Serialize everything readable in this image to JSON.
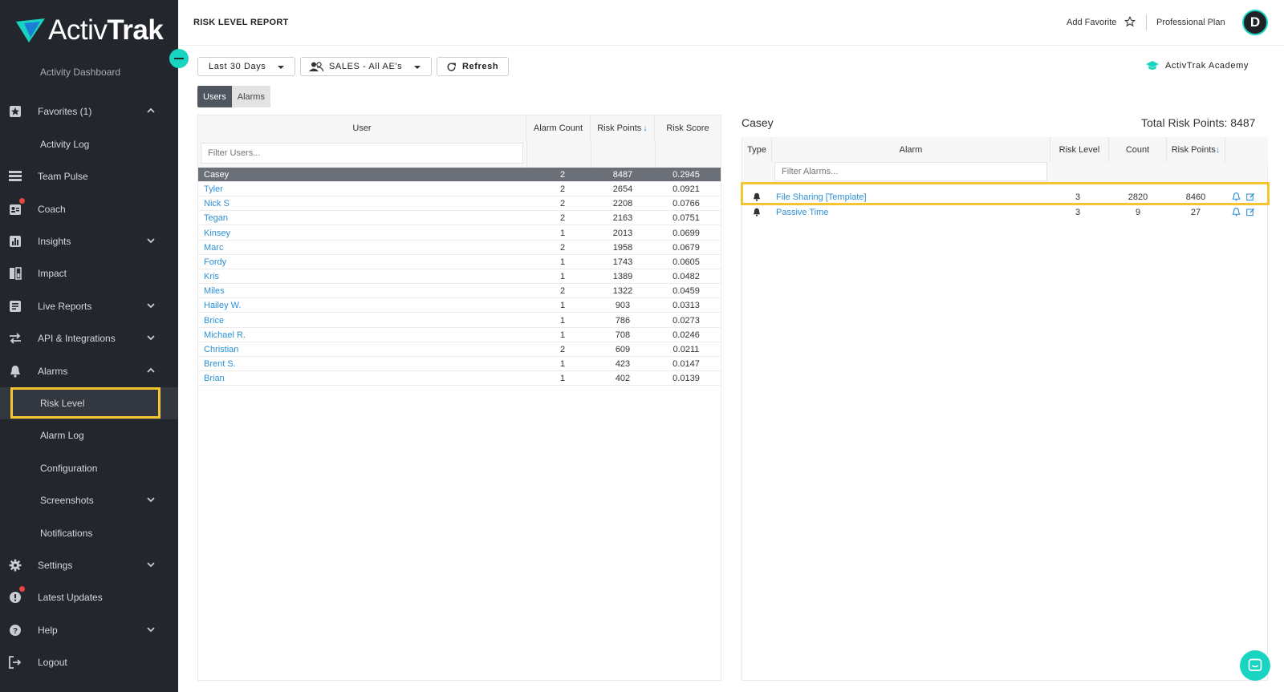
{
  "brand": {
    "logo_a": "Activ",
    "logo_b": "Trak",
    "accent": "#19d4c1",
    "highlight": "#f4c431"
  },
  "sidebar": {
    "items": [
      {
        "label": "Activity Dashboard",
        "icon": "none",
        "sub": true
      },
      {
        "label": "Favorites (1)",
        "icon": "star-box-icon",
        "chevron": "up"
      },
      {
        "label": "Activity Log",
        "icon": "none",
        "sub": true
      },
      {
        "label": "Team Pulse",
        "icon": "team-pulse-icon"
      },
      {
        "label": "Coach",
        "icon": "coach-icon",
        "dot": true
      },
      {
        "label": "Insights",
        "icon": "insights-icon",
        "chevron": "down"
      },
      {
        "label": "Impact",
        "icon": "impact-icon"
      },
      {
        "label": "Live Reports",
        "icon": "reports-icon",
        "chevron": "down"
      },
      {
        "label": "API & Integrations",
        "icon": "swap-icon",
        "chevron": "down"
      },
      {
        "label": "Alarms",
        "icon": "bell-icon",
        "chevron": "up"
      },
      {
        "label": "Risk Level",
        "icon": "none",
        "sub": true,
        "active": true
      },
      {
        "label": "Alarm Log",
        "icon": "none",
        "sub": true
      },
      {
        "label": "Configuration",
        "icon": "none",
        "sub": true
      },
      {
        "label": "Screenshots",
        "icon": "none",
        "sub": true,
        "chevron": "down"
      },
      {
        "label": "Notifications",
        "icon": "none",
        "sub": true
      },
      {
        "label": "Settings",
        "icon": "gear-icon",
        "chevron": "down"
      },
      {
        "label": "Latest Updates",
        "icon": "updates-icon",
        "dot": true
      },
      {
        "label": "Help",
        "icon": "help-icon",
        "chevron": "down"
      },
      {
        "label": "Logout",
        "icon": "logout-icon"
      }
    ]
  },
  "header": {
    "title": "RISK LEVEL REPORT",
    "add_favorite": "Add Favorite",
    "plan": "Professional Plan",
    "avatar_initial": "D"
  },
  "toolbar": {
    "date_range": "Last 30 Days",
    "group": "SALES - All AE's",
    "refresh": "Refresh",
    "academy": "ActivTrak Academy"
  },
  "tabs": {
    "users": "Users",
    "alarms": "Alarms"
  },
  "users_table": {
    "columns": [
      "User",
      "Alarm Count",
      "Risk Points",
      "Risk Score"
    ],
    "filter_placeholder": "Filter Users...",
    "rows": [
      {
        "user": "Casey",
        "alarm_count": "2",
        "risk_points": "8487",
        "risk_score": "0.2945"
      },
      {
        "user": "Tyler",
        "alarm_count": "2",
        "risk_points": "2654",
        "risk_score": "0.0921"
      },
      {
        "user": "Nick S",
        "alarm_count": "2",
        "risk_points": "2208",
        "risk_score": "0.0766"
      },
      {
        "user": "Tegan",
        "alarm_count": "2",
        "risk_points": "2163",
        "risk_score": "0.0751"
      },
      {
        "user": "Kinsey",
        "alarm_count": "1",
        "risk_points": "2013",
        "risk_score": "0.0699"
      },
      {
        "user": "Marc",
        "alarm_count": "2",
        "risk_points": "1958",
        "risk_score": "0.0679"
      },
      {
        "user": "Fordy",
        "alarm_count": "1",
        "risk_points": "1743",
        "risk_score": "0.0605"
      },
      {
        "user": "Kris",
        "alarm_count": "1",
        "risk_points": "1389",
        "risk_score": "0.0482"
      },
      {
        "user": "Miles",
        "alarm_count": "2",
        "risk_points": "1322",
        "risk_score": "0.0459"
      },
      {
        "user": "Hailey W.",
        "alarm_count": "1",
        "risk_points": "903",
        "risk_score": "0.0313"
      },
      {
        "user": "Brice",
        "alarm_count": "1",
        "risk_points": "786",
        "risk_score": "0.0273"
      },
      {
        "user": "Michael R.",
        "alarm_count": "1",
        "risk_points": "708",
        "risk_score": "0.0246"
      },
      {
        "user": "Christian",
        "alarm_count": "2",
        "risk_points": "609",
        "risk_score": "0.0211"
      },
      {
        "user": "Brent S.",
        "alarm_count": "1",
        "risk_points": "423",
        "risk_score": "0.0147"
      },
      {
        "user": "Brian",
        "alarm_count": "1",
        "risk_points": "402",
        "risk_score": "0.0139"
      }
    ]
  },
  "detail": {
    "user": "Casey",
    "total_label": "Total Risk Points: 8487",
    "columns": [
      "Type",
      "Alarm",
      "Risk Level",
      "Count",
      "Risk Points"
    ],
    "filter_placeholder": "Filter Alarms...",
    "rows": [
      {
        "alarm": "File Sharing [Template]",
        "risk_level": "3",
        "count": "2820",
        "risk_points": "8460"
      },
      {
        "alarm": "Passive Time",
        "risk_level": "3",
        "count": "9",
        "risk_points": "27"
      }
    ]
  }
}
